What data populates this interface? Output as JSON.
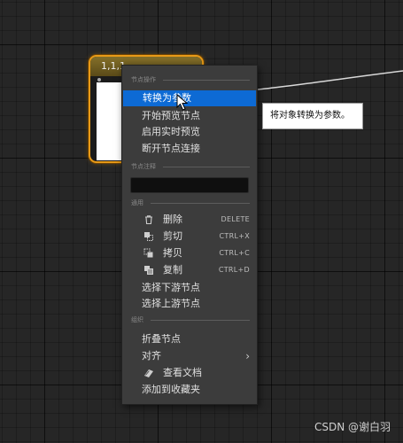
{
  "node": {
    "title": "1,1,1"
  },
  "menu": {
    "sections": [
      {
        "header": "节点操作"
      },
      {
        "header": "节点注释"
      },
      {
        "header": "通用"
      },
      {
        "header": "组织"
      }
    ],
    "node_actions": [
      {
        "label": "转换为参数",
        "selected": true
      },
      {
        "label": "开始预览节点"
      },
      {
        "label": "启用实时预览"
      },
      {
        "label": "断开节点连接"
      }
    ],
    "comment": {
      "value": ""
    },
    "general": [
      {
        "label": "删除",
        "shortcut": "DELETE",
        "icon": "trash-icon"
      },
      {
        "label": "剪切",
        "shortcut": "CTRL+X",
        "icon": "cut-icon"
      },
      {
        "label": "拷贝",
        "shortcut": "CTRL+C",
        "icon": "copy-icon"
      },
      {
        "label": "复制",
        "shortcut": "CTRL+D",
        "icon": "duplicate-icon"
      },
      {
        "label": "选择下游节点"
      },
      {
        "label": "选择上游节点"
      }
    ],
    "organize": [
      {
        "label": "折叠节点"
      },
      {
        "label": "对齐",
        "submenu": true
      },
      {
        "label": "查看文档",
        "icon": "document-icon"
      },
      {
        "label": "添加到收藏夹"
      }
    ]
  },
  "tooltip": {
    "text": "将对象转换为参数。"
  },
  "watermark": {
    "text": "CSDN @谢白羽"
  },
  "colors": {
    "selection": "#0d6ad4",
    "node_border": "#e89a17",
    "menu_bg": "#3c3c3c"
  }
}
